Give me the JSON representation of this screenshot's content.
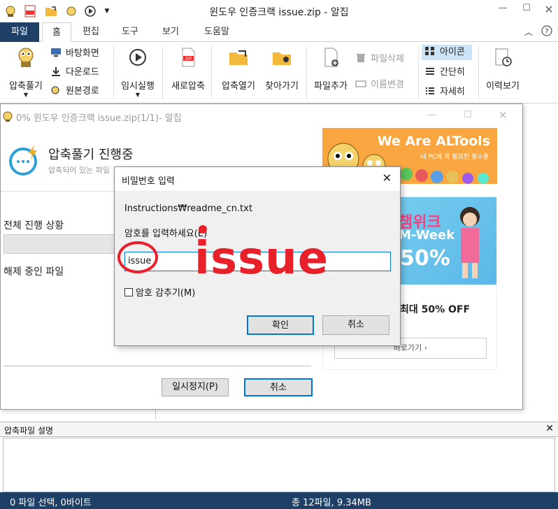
{
  "window": {
    "title": "윈도우 인증크랙 issue.zip - 알집"
  },
  "menu": {
    "tabs": [
      "파일",
      "홈",
      "편집",
      "도구",
      "보기",
      "도움말"
    ]
  },
  "ribbon": {
    "extract": "압축풀기",
    "desktop": "바탕화면",
    "downloads": "다운로드",
    "original_path": "원본경로",
    "temp_run": "임시실행",
    "new_zip": "새로압축",
    "open_zip": "압축열기",
    "find": "찾아가기",
    "add_file": "파일추가",
    "delete_file": "파일삭제",
    "rename": "이름변경",
    "view_icon": "아이콘",
    "view_simple": "간단히",
    "view_detail": "자세히",
    "history": "이력보기"
  },
  "progress_dialog": {
    "title": "0% 윈도우 인증크랙 issue.zip(1/1)- 알집",
    "heading": "압축풀기 진행중",
    "subheading": "압축되어 있는 파일",
    "overall_label": "전체 진행 상황",
    "current_label": "해제 중인 파일",
    "pause_button": "일시정지(P)",
    "cancel_button": "취소"
  },
  "ad": {
    "banner_title": "We Are ALTools",
    "banner_sub": "내 PC에 꼭 필요한 필수품",
    "promo_big": "챔위크",
    "promo_week": "M-Week",
    "promo_off": "50%",
    "promo_offer": "최대 50% OFF",
    "promo_button": "바로가기 ›"
  },
  "password_dialog": {
    "title": "비밀번호 입력",
    "file_path": "Instructions₩readme_cn.txt",
    "prompt": "암호를 입력하세요(E)",
    "value": "issue",
    "hide_label": "암호 감추기(M)",
    "ok_button": "확인",
    "cancel_button": "취소"
  },
  "annotation": {
    "text": "issue"
  },
  "description_panel": {
    "title": "압축파일 설명"
  },
  "status_bar": {
    "selection": "0 파일 선택,  0바이트",
    "total": "총 12파일,   9.34MB"
  },
  "colors": {
    "accent": "#1e3f66",
    "annotation": "#e8202a",
    "ad_orange": "#f9a640",
    "input_focus": "#0078d7"
  }
}
